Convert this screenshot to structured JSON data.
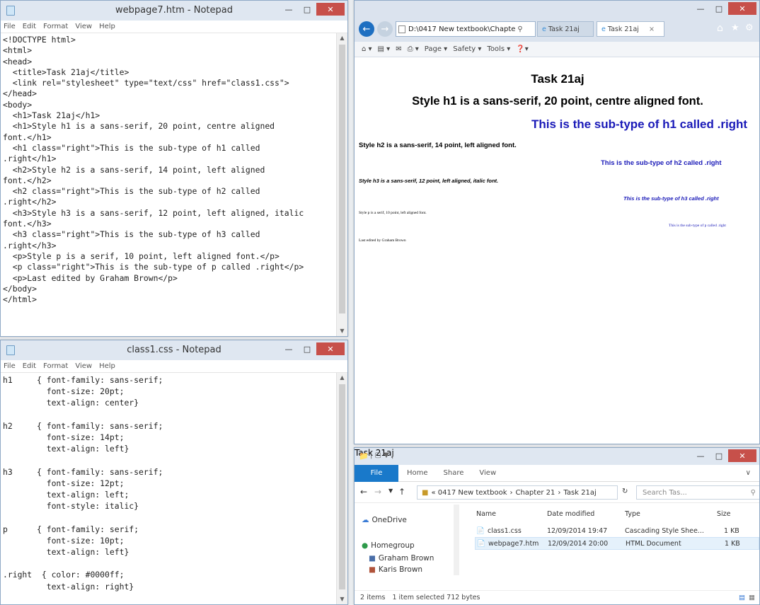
{
  "notepad1": {
    "title": "webpage7.htm - Notepad",
    "menu": [
      "File",
      "Edit",
      "Format",
      "View",
      "Help"
    ],
    "lines": [
      "<!DOCTYPE html>",
      "<html>",
      "<head>",
      "  <title>Task 21aj</title>",
      "  <link rel=\"stylesheet\" type=\"text/css\" href=\"class1.css\">",
      "</head>",
      "<body>",
      "  <h1>Task 21aj</h1>",
      "  <h1>Style h1 is a sans-serif, 20 point, centre aligned",
      "font.</h1>",
      "  <h1 class=\"right\">This is the sub-type of h1 called",
      ".right</h1>",
      "  <h2>Style h2 is a sans-serif, 14 point, left aligned",
      "font.</h2>",
      "  <h2 class=\"right\">This is the sub-type of h2 called",
      ".right</h2>",
      "  <h3>Style h3 is a sans-serif, 12 point, left aligned, italic",
      "font.</h3>",
      "  <h3 class=\"right\">This is the sub-type of h3 called",
      ".right</h3>",
      "  <p>Style p is a serif, 10 point, left aligned font.</p>",
      "  <p class=\"right\">This is the sub-type of p called .right</p>",
      "  <p>Last edited by Graham Brown</p>",
      "</body>",
      "</html>"
    ]
  },
  "notepad2": {
    "title": "class1.css - Notepad",
    "menu": [
      "File",
      "Edit",
      "Format",
      "View",
      "Help"
    ],
    "lines": [
      "h1     { font-family: sans-serif;",
      "         font-size: 20pt;",
      "         text-align: center}",
      "",
      "h2     { font-family: sans-serif;",
      "         font-size: 14pt;",
      "         text-align: left}",
      "",
      "h3     { font-family: sans-serif;",
      "         font-size: 12pt;",
      "         text-align: left;",
      "         font-style: italic}",
      "",
      "p      { font-family: serif;",
      "         font-size: 10pt;",
      "         text-align: left}",
      "",
      ".right  { color: #0000ff;",
      "         text-align: right}"
    ]
  },
  "browser": {
    "address": "D:\\0417 New textbook\\Chapte",
    "tabs": [
      "Task 21aj",
      "Task 21aj"
    ],
    "toolbar": [
      "Page ▾",
      "Safety ▾",
      "Tools ▾"
    ],
    "content": {
      "h1_title": "Task 21aj",
      "h1_style": "Style h1 is a sans-serif, 20 point, centre aligned font.",
      "h1_right": "This is the sub-type of h1 called .right",
      "h2_style": "Style h2 is a sans-serif, 14 point, left aligned font.",
      "h2_right": "This is the sub-type of h2 called .right",
      "h3_style": "Style h3 is a sans-serif, 12 point, left aligned, italic font.",
      "h3_right": "This is the sub-type of h3 called .right",
      "p_style": "Style p is a serif, 10 point, left aligned font.",
      "p_right": "This is the sub-type of p called .right",
      "p_last": "Last edited by Graham Brown"
    },
    "link_color": "#1a1ab8"
  },
  "explorer": {
    "title": "Task 21aj",
    "ribbon_file": "File",
    "ribbon_tabs": [
      "Home",
      "Share",
      "View"
    ],
    "breadcrumb": [
      "« 0417 New textbook",
      "Chapter 21",
      "Task 21aj"
    ],
    "search_placeholder": "Search Tas...",
    "nav": [
      "OneDrive",
      "Homegroup",
      "Graham Brown",
      "Karis Brown"
    ],
    "columns": [
      "Name",
      "Date modified",
      "Type",
      "Size"
    ],
    "files": [
      {
        "name": "class1.css",
        "date": "12/09/2014 19:47",
        "type": "Cascading Style Shee...",
        "size": "1 KB"
      },
      {
        "name": "webpage7.htm",
        "date": "12/09/2014 20:00",
        "type": "HTML Document",
        "size": "1 KB"
      }
    ],
    "status_items": "2 items",
    "status_selected": "1 item selected  712 bytes"
  }
}
